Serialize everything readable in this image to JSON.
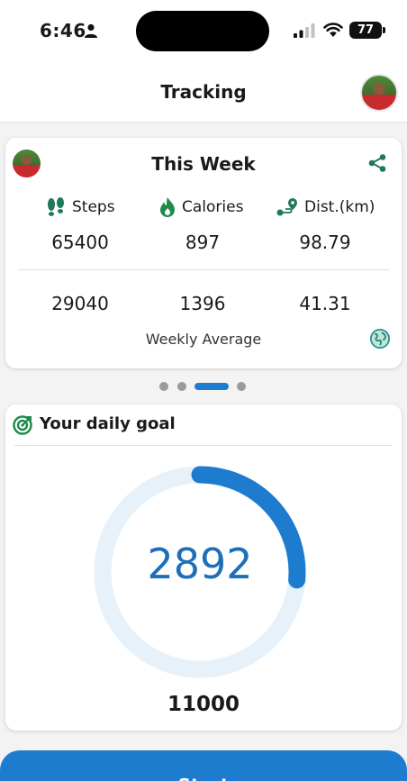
{
  "status_bar": {
    "time": "6:46",
    "battery": "77",
    "icons": [
      "person-icon",
      "signal-icon",
      "wifi-icon",
      "battery-icon"
    ]
  },
  "header": {
    "title": "Tracking",
    "avatar_icon": "profile-avatar"
  },
  "week_card": {
    "title": "This Week",
    "share_icon": "share-icon",
    "columns": [
      {
        "label": "Steps",
        "icon": "footprints-icon",
        "total": "65400",
        "average": "29040"
      },
      {
        "label": "Calories",
        "icon": "flame-icon",
        "total": "897",
        "average": "1396"
      },
      {
        "label": "Dist.(km)",
        "icon": "route-icon",
        "total": "98.79",
        "average": "41.31"
      }
    ],
    "average_label": "Weekly Average",
    "globe_icon": "globe-icon"
  },
  "pager": {
    "count": 4,
    "active_index": 2
  },
  "goal_card": {
    "title": "Your daily goal",
    "icon": "target-icon",
    "current": "2892",
    "target": "11000",
    "progress_fraction": 0.2629
  },
  "colors": {
    "accent": "#1e7ccf",
    "ring_track": "#e6f1fa",
    "ring_value": "#1e6fb8",
    "icon_green": "#1f7a5a",
    "flame_green": "#1f8a4c"
  },
  "start_button": {
    "label": "Start"
  }
}
